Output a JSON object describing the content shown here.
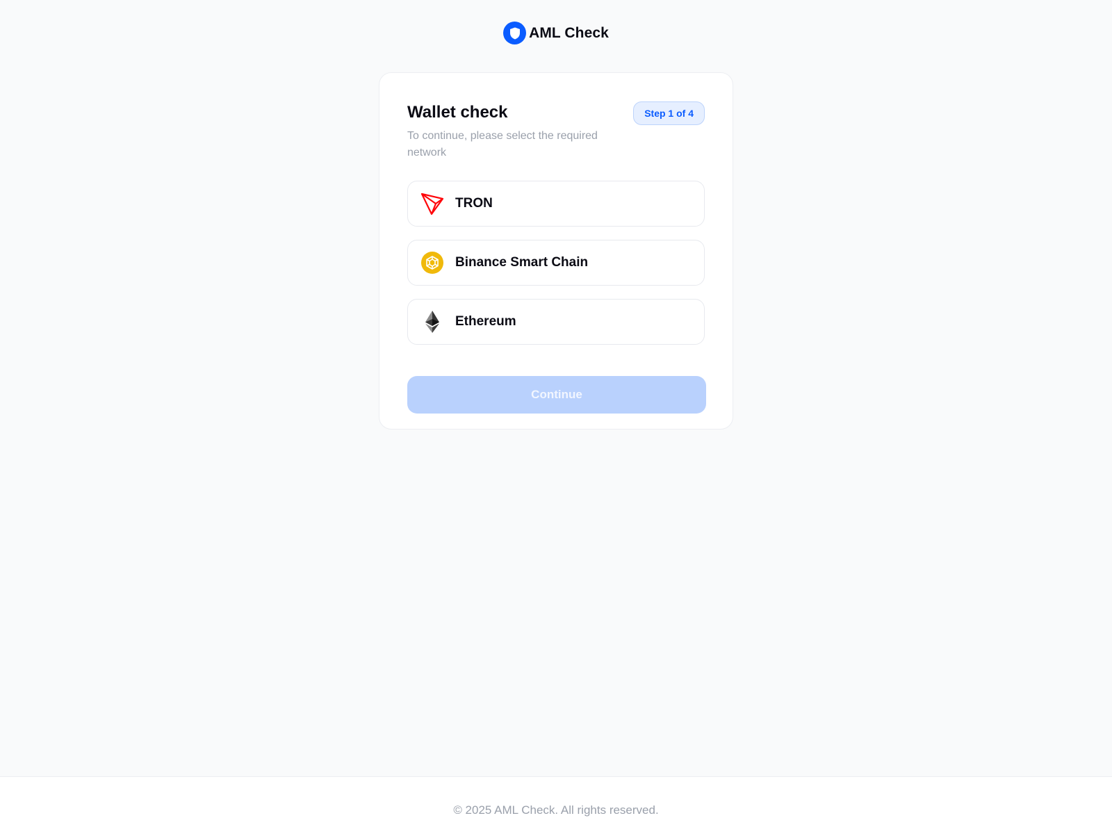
{
  "header": {
    "brand_name": "AML Check",
    "logo_icon": "shield-icon"
  },
  "card": {
    "title": "Wallet check",
    "subtitle": "To continue, please select the required network",
    "step_badge": "Step 1 of 4",
    "networks": [
      {
        "label": "TRON",
        "icon": "tron-icon"
      },
      {
        "label": "Binance Smart Chain",
        "icon": "bnb-icon"
      },
      {
        "label": "Ethereum",
        "icon": "ethereum-icon"
      }
    ],
    "continue_label": "Continue"
  },
  "footer": {
    "text": "© 2025 AML Check. All rights reserved."
  },
  "colors": {
    "accent": "#0b5cff",
    "tron": "#ff060a",
    "bnb": "#f0b90b",
    "button_disabled": "#b9d1fd",
    "page_bg": "#f9fafb"
  }
}
